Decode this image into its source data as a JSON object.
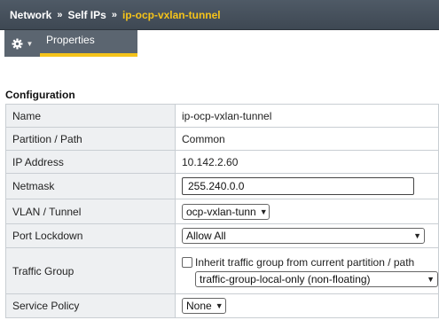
{
  "breadcrumb": {
    "items": [
      "Network",
      "Self IPs",
      "ip-ocp-vxlan-tunnel"
    ],
    "separator": "»"
  },
  "tabs": {
    "properties_label": "Properties"
  },
  "icons": {
    "gear": "gear-icon",
    "menu_chevron": "chevron-down-icon",
    "select_caret": "chevron-down-icon"
  },
  "colors": {
    "header_bg": "#4a5561",
    "accent": "#f5c31a",
    "label_bg": "#eef0f2"
  },
  "configuration": {
    "title": "Configuration",
    "rows": {
      "name": {
        "label": "Name",
        "value": "ip-ocp-vxlan-tunnel"
      },
      "partition": {
        "label": "Partition / Path",
        "value": "Common"
      },
      "ip_address": {
        "label": "IP Address",
        "value": "10.142.2.60"
      },
      "netmask": {
        "label": "Netmask",
        "value": "255.240.0.0"
      },
      "vlan": {
        "label": "VLAN / Tunnel",
        "selected": "ocp-vxlan-tunn"
      },
      "port_lockdown": {
        "label": "Port Lockdown",
        "selected": "Allow All"
      },
      "traffic_group": {
        "label": "Traffic Group",
        "inherit_label": "Inherit traffic group from current partition / path",
        "inherit_checked": false,
        "selected": "traffic-group-local-only (non-floating)"
      },
      "service_policy": {
        "label": "Service Policy",
        "selected": "None"
      }
    }
  }
}
